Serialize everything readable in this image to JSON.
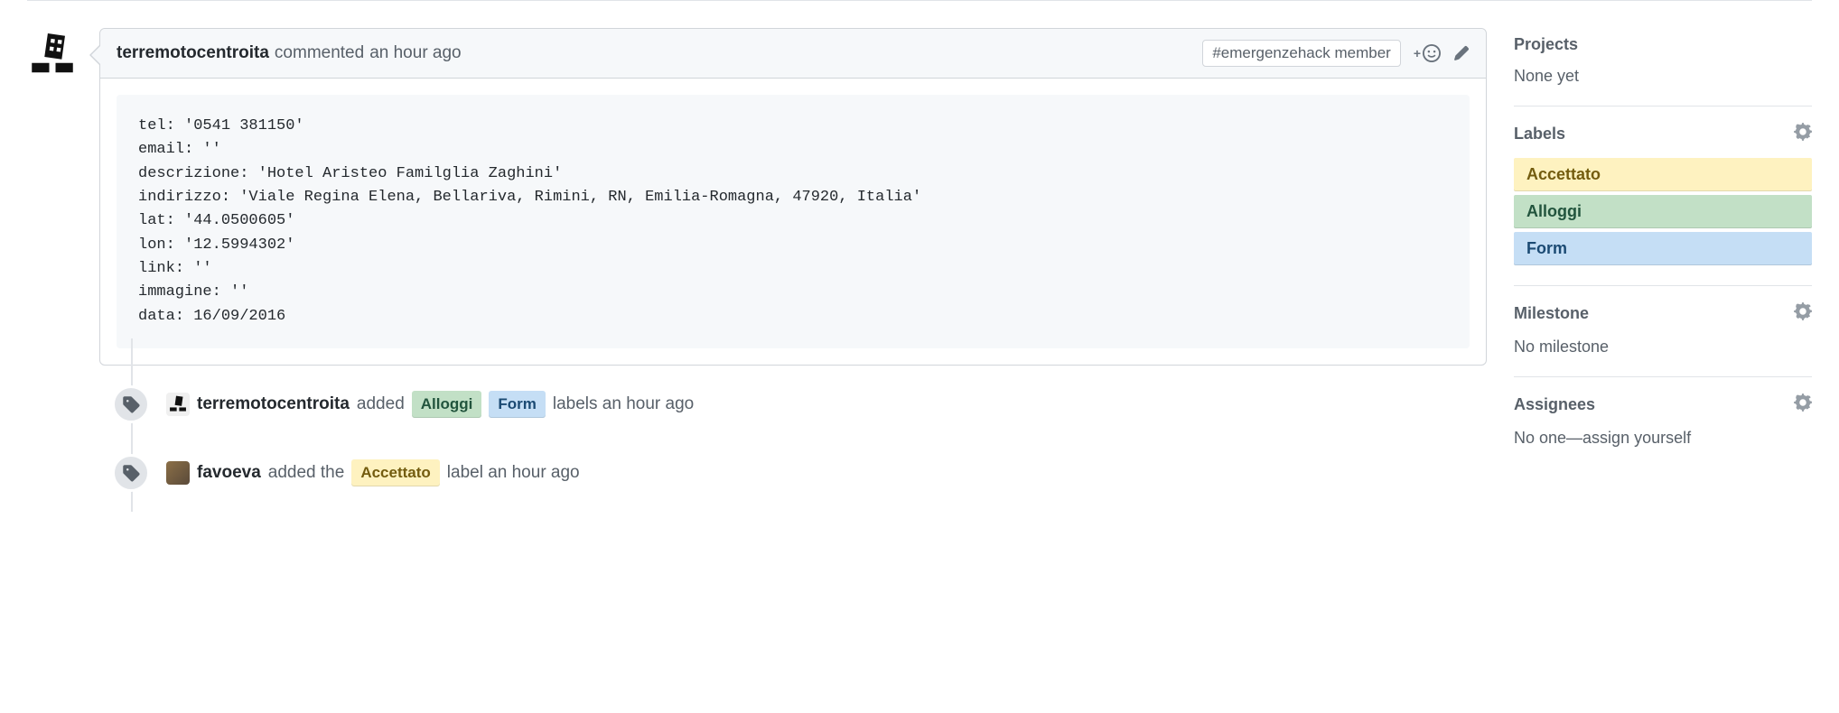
{
  "comment": {
    "author": "terremotocentroita",
    "action": "commented",
    "time": "an hour ago",
    "badge": "#emergenzehack member",
    "code": "tel: '0541 381150'\nemail: ''\ndescrizione: 'Hotel Aristeo Familglia Zaghini'\nindirizzo: 'Viale Regina Elena, Bellariva, Rimini, RN, Emilia-Romagna, 47920, Italia'\nlat: '44.0500605'\nlon: '12.5994302'\nlink: ''\nimmagine: ''\ndata: 16/09/2016"
  },
  "events": {
    "e1": {
      "author": "terremotocentroita",
      "verb": "added",
      "label1": "Alloggi",
      "label2": "Form",
      "suffix": "labels an hour ago"
    },
    "e2": {
      "author": "favoeva",
      "verb": "added the",
      "label1": "Accettato",
      "suffix": "label an hour ago"
    }
  },
  "sidebar": {
    "projects": {
      "title": "Projects",
      "value": "None yet"
    },
    "labels": {
      "title": "Labels",
      "items": {
        "l1": "Accettato",
        "l2": "Alloggi",
        "l3": "Form"
      }
    },
    "milestone": {
      "title": "Milestone",
      "value": "No milestone"
    },
    "assignees": {
      "title": "Assignees",
      "value": "No one—assign yourself"
    }
  }
}
